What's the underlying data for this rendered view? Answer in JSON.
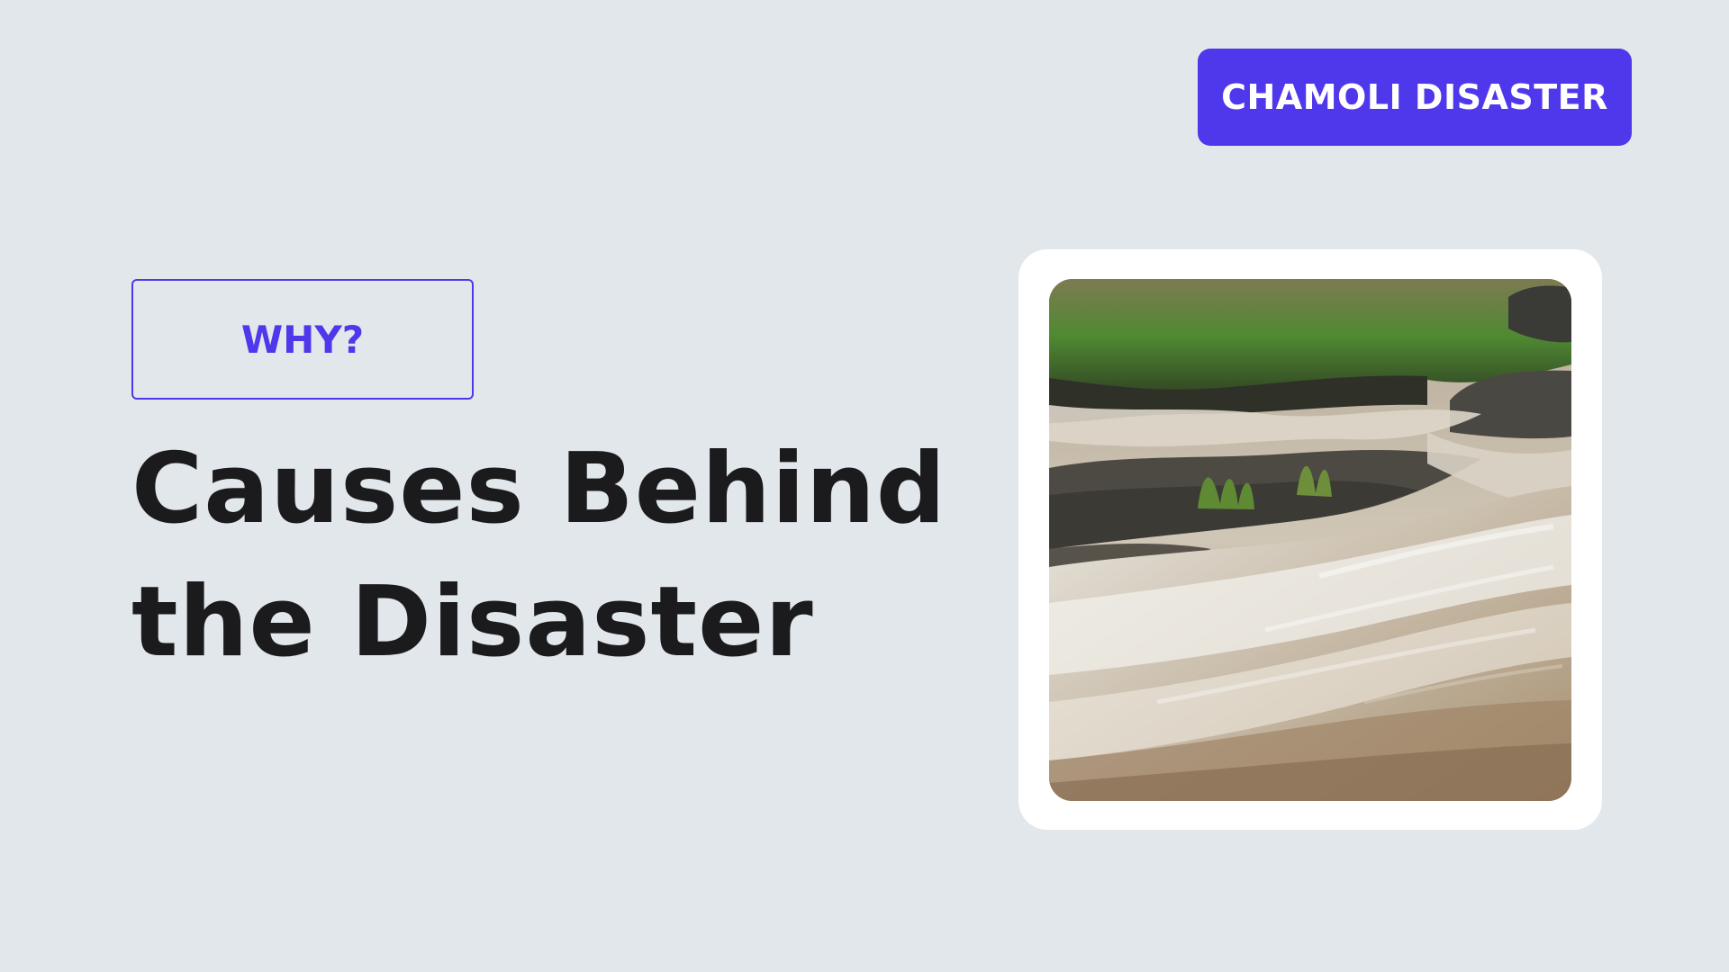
{
  "tag": {
    "label": "CHAMOLI DISASTER"
  },
  "eyebrow": {
    "label": "WHY?"
  },
  "title": {
    "line1": "Causes Behind",
    "line2": "the Disaster"
  },
  "image": {
    "subject": "river-rapids-photo"
  },
  "colors": {
    "background": "#e2e7ec",
    "accent": "#4f38ec",
    "title_text": "#1b1b1d",
    "card": "#ffffff"
  }
}
